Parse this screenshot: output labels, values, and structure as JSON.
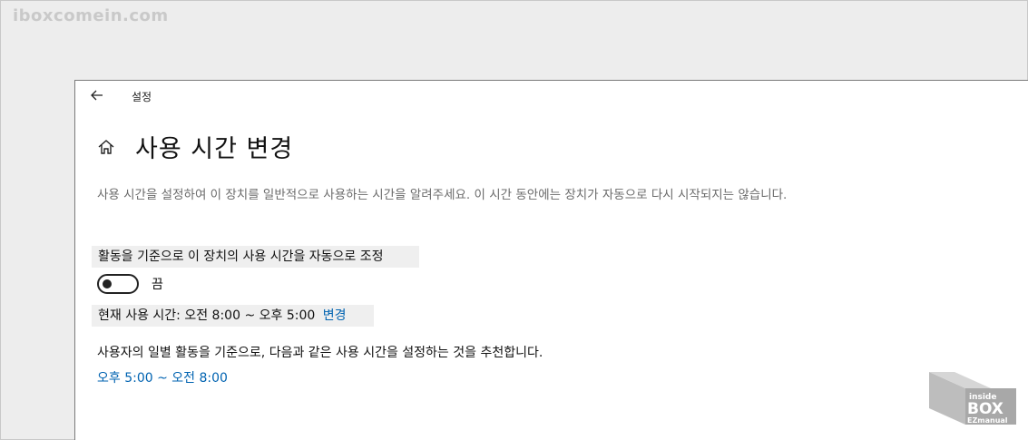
{
  "watermark": "iboxcomein.com",
  "window": {
    "title": "설정"
  },
  "page": {
    "title": "사용 시간 변경",
    "description": "사용 시간을 설정하여 이 장치를 일반적으로 사용하는 시간을 알려주세요. 이 시간 동안에는 장치가 자동으로 다시 시작되지는 않습니다."
  },
  "auto_adjust": {
    "label": "활동을 기준으로 이 장치의 사용 시간을 자동으로 조정",
    "state": "off",
    "state_text": "끔"
  },
  "current": {
    "text": "현재 사용 시간: 오전 8:00 ~ 오후 5:00",
    "change_link": "변경"
  },
  "recommendation": {
    "text": "사용자의 일별 활동을 기준으로, 다음과 같은 사용 시간을 설정하는 것을 추천합니다.",
    "hours": "오후 5:00 ~ 오전 8:00"
  },
  "logo": {
    "line1": "inside",
    "line2": "BOX",
    "line3": "EZmanual"
  },
  "colors": {
    "accent": "#0063b1",
    "description": "#6b6b6b",
    "highlight_bg": "#efefef"
  },
  "icons": [
    "back-arrow-icon",
    "home-icon"
  ]
}
